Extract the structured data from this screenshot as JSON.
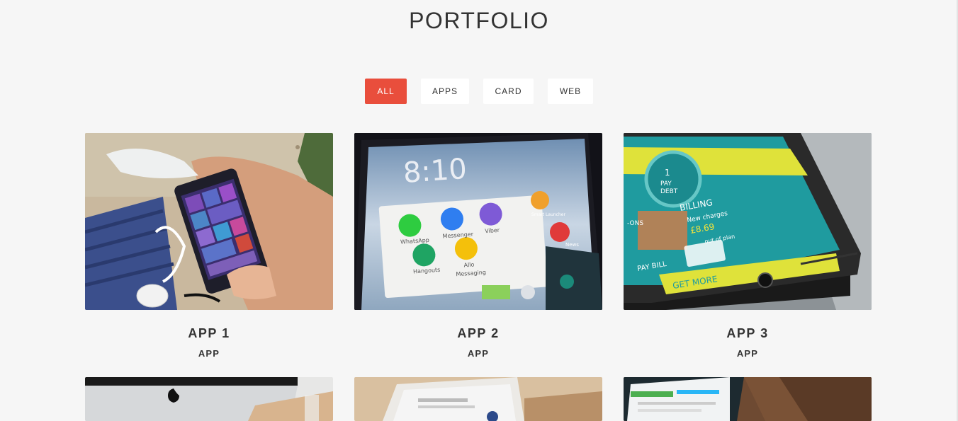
{
  "section": {
    "title": "PORTFOLIO"
  },
  "filters": [
    {
      "label": "ALL",
      "active": true
    },
    {
      "label": "APPS",
      "active": false
    },
    {
      "label": "CARD",
      "active": false
    },
    {
      "label": "WEB",
      "active": false
    }
  ],
  "items": [
    {
      "title": "APP 1",
      "category": "APP",
      "image": "hand-holding-windows-phone-photo"
    },
    {
      "title": "APP 2",
      "category": "APP",
      "image": "android-phone-home-screen-photo"
    },
    {
      "title": "APP 3",
      "category": "APP",
      "image": "phone-billing-app-photo"
    },
    {
      "title": "",
      "category": "",
      "image": "imac-desk-photo"
    },
    {
      "title": "",
      "category": "",
      "image": "laptop-on-desk-photo"
    },
    {
      "title": "",
      "category": "",
      "image": "web-dashboard-screen-photo"
    }
  ],
  "phone_screen_2": {
    "clock": "8:10",
    "apps": [
      "WhatsApp",
      "Messenger",
      "Viber",
      "Hangouts",
      "Allo",
      "Messaging",
      "News",
      "Smart Launcher"
    ]
  },
  "phone_screen_3": {
    "badge_line1": "1",
    "badge_line2": "PAY",
    "badge_line3": "DEBT",
    "billing_heading": "BILLING",
    "billing_line1": "New charges",
    "billing_amount": "£8.69",
    "billing_line2": "out of plan",
    "addons": "-ONS",
    "pay_bill": "PAY BILL",
    "get_more": "GET MORE"
  },
  "colors": {
    "accent": "#e94e3c",
    "background": "#f6f6f6",
    "button": "#ffffff",
    "text": "#333333"
  }
}
